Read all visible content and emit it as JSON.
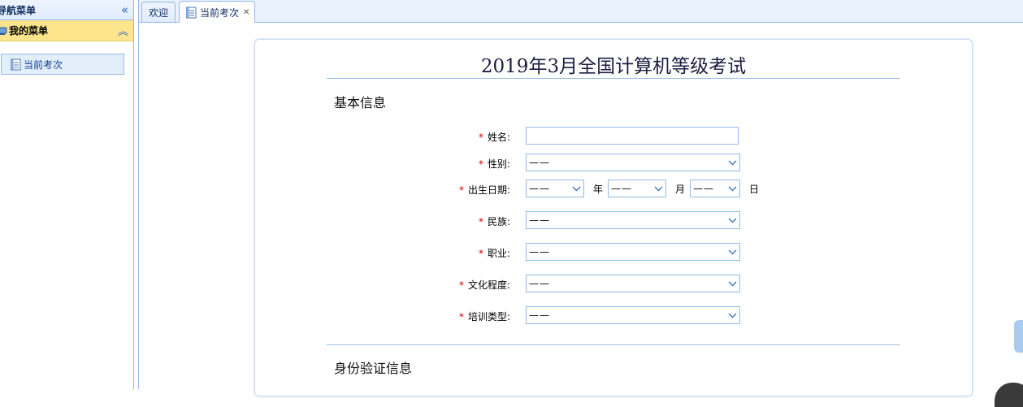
{
  "nav": {
    "title": "导航菜单",
    "group_title": "我的菜单",
    "items": [
      {
        "label": "当前考次"
      }
    ]
  },
  "tabs": [
    {
      "label": "欢迎",
      "active": false
    },
    {
      "label": "当前考次",
      "active": true,
      "closable": true
    }
  ],
  "form": {
    "title": "2019年3月全国计算机等级考试",
    "sections": {
      "basic": "基本信息",
      "identity": "身份验证信息"
    },
    "fields": {
      "name": {
        "label": "姓名:",
        "value": ""
      },
      "gender": {
        "label": "性别:",
        "value": "——"
      },
      "birth": {
        "label": "出生日期:",
        "year": "——",
        "year_unit": "年",
        "month": "——",
        "month_unit": "月",
        "day": "——",
        "day_unit": "日"
      },
      "ethnicity": {
        "label": "民族:",
        "value": "——"
      },
      "occupation": {
        "label": "职业:",
        "value": "——"
      },
      "education": {
        "label": "文化程度:",
        "value": "——"
      },
      "training": {
        "label": "培训类型:",
        "value": "——"
      }
    },
    "required_mark": "*"
  },
  "colors": {
    "accent": "#95b8e7",
    "menu_group_bg": "#fde58e",
    "required": "#cc0000"
  }
}
